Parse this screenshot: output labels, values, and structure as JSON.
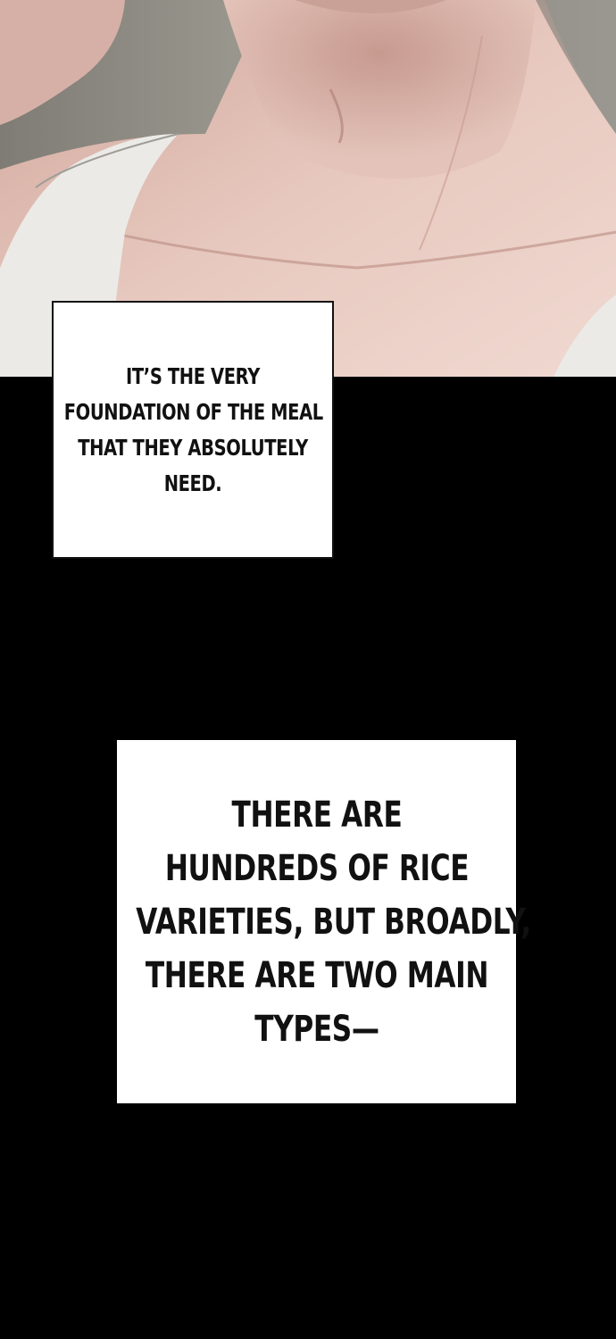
{
  "panel": {
    "art_description_icon": "character-chest-illustration",
    "colors": {
      "skin": "#e6c7bd",
      "skin_shadow": "#c99f94",
      "background": "#8f8d86",
      "shirt": "#e9e8e4",
      "black": "#000000"
    }
  },
  "captions": [
    {
      "lines": [
        "IT’S THE VERY",
        "FOUNDATION OF THE MEAL",
        "THAT THEY ABSOLUTELY",
        "NEED."
      ]
    },
    {
      "lines": [
        "THERE ARE",
        "HUNDREDS OF RICE",
        "VARIETIES, BUT BROADLY,",
        "THERE ARE TWO MAIN",
        "TYPES—"
      ]
    }
  ]
}
